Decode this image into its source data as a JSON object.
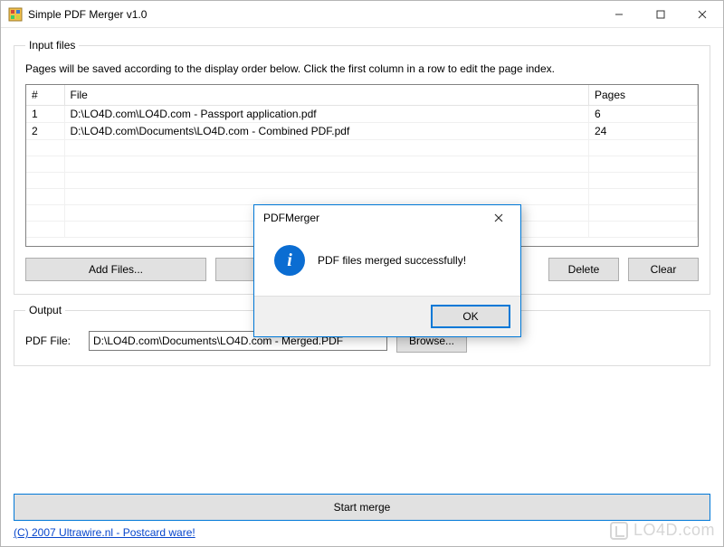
{
  "window": {
    "title": "Simple PDF Merger v1.0"
  },
  "input": {
    "legend": "Input files",
    "instruction": "Pages will be saved according to the display order below. Click the first column in a row to edit the page index.",
    "columns": {
      "index": "#",
      "file": "File",
      "pages": "Pages"
    },
    "rows": [
      {
        "index": "1",
        "file": "D:\\LO4D.com\\LO4D.com - Passport application.pdf",
        "pages": "6"
      },
      {
        "index": "2",
        "file": "D:\\LO4D.com\\Documents\\LO4D.com - Combined PDF.pdf",
        "pages": "24"
      }
    ],
    "buttons": {
      "add": "Add Files...",
      "delete": "Delete",
      "clear": "Clear"
    }
  },
  "output": {
    "legend": "Output",
    "label": "PDF File:",
    "value": "D:\\LO4D.com\\Documents\\LO4D.com - Merged.PDF",
    "browse": "Browse..."
  },
  "start_label": "Start merge",
  "footer_link": "(C) 2007 Ultrawire.nl - Postcard ware!",
  "dialog": {
    "title": "PDFMerger",
    "message": "PDF files merged successfully!",
    "ok": "OK"
  },
  "watermark": "LO4D.com"
}
